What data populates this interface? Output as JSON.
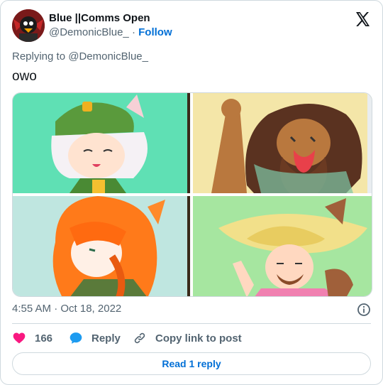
{
  "author": {
    "display_name": "Blue ||Comms Open",
    "handle": "@DemonicBlue_",
    "separator": "·",
    "follow_label": "Follow"
  },
  "tweet": {
    "replying_to": "Replying to @DemonicBlue_",
    "text": "owo",
    "timestamp": "4:55 AM · Oct 18, 2022"
  },
  "actions": {
    "like_count": "166",
    "reply_label": "Reply",
    "copy_label": "Copy link to post"
  },
  "read_reply_label": "Read 1 reply",
  "colors": {
    "like": "#f91880",
    "reply": "#1d9bf0",
    "link": "#006fd6",
    "muted": "#536471",
    "border": "#cfd9de"
  },
  "icons": [
    "x-logo-icon",
    "info-icon",
    "heart-icon",
    "reply-bubble-icon",
    "link-icon"
  ],
  "media": {
    "panels": [
      "top-left-artwork",
      "top-right-artwork",
      "bottom-left-artwork",
      "bottom-right-artwork"
    ]
  }
}
